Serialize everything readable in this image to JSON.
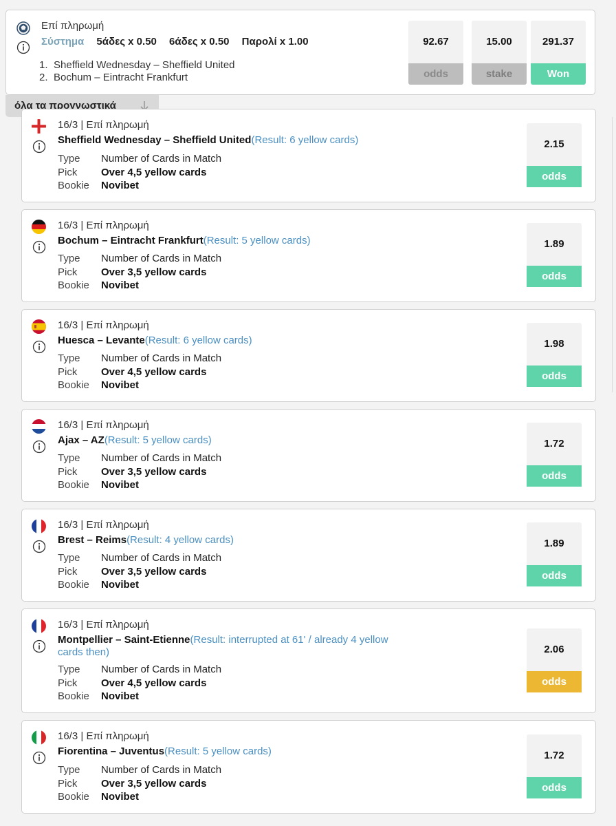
{
  "summary": {
    "payout_mode": "Επί πληρωμή",
    "system_label": "Σύστημα",
    "system_parts": [
      "5άδες x 0.50",
      "6άδες x 0.50",
      "Παρολί x 1.00"
    ],
    "matches": [
      {
        "num": "1.",
        "name": "Sheffield Wednesday – Sheffield United"
      },
      {
        "num": "2.",
        "name": "Bochum – Eintracht Frankfurt"
      }
    ],
    "boxes": [
      {
        "value": "92.67",
        "label": "odds"
      },
      {
        "value": "15.00",
        "label": "stake"
      },
      {
        "value": "291.37",
        "label": "Won"
      }
    ]
  },
  "all_predictions_tab": "όλα τα προγνωστικά",
  "row_labels": {
    "type": "Type",
    "pick": "Pick",
    "bookie": "Bookie"
  },
  "odds_label": "odds",
  "colors": {
    "won": "#5fd3a9",
    "void": "#ecb833",
    "result_text": "#4a8fc1"
  },
  "bets": [
    {
      "flag": "england-flag-icon",
      "date": "16/3",
      "payout": "Επί πληρωμή",
      "teams": "Sheffield Wednesday – Sheffield United",
      "result": "(Result: 6 yellow cards)",
      "type": "Number of Cards in Match",
      "pick": "Over 4,5 yellow cards",
      "bookie": "Novibet",
      "odds": "2.15",
      "status": "won"
    },
    {
      "flag": "germany-flag-icon",
      "date": "16/3",
      "payout": "Επί πληρωμή",
      "teams": "Bochum – Eintracht Frankfurt",
      "result": "(Result: 5 yellow cards)",
      "type": "Number of Cards in Match",
      "pick": "Over 3,5 yellow cards",
      "bookie": "Novibet",
      "odds": "1.89",
      "status": "won"
    },
    {
      "flag": "spain-flag-icon",
      "date": "16/3",
      "payout": "Επί πληρωμή",
      "teams": "Huesca – Levante",
      "result": "(Result: 6 yellow cards)",
      "type": "Number of Cards in Match",
      "pick": "Over 4,5 yellow cards",
      "bookie": "Novibet",
      "odds": "1.98",
      "status": "won"
    },
    {
      "flag": "netherlands-flag-icon",
      "date": "16/3",
      "payout": "Επί πληρωμή",
      "teams": "Ajax – AZ",
      "result": "(Result: 5 yellow cards)",
      "type": "Number of Cards in Match",
      "pick": "Over 3,5 yellow cards",
      "bookie": "Novibet",
      "odds": "1.72",
      "status": "won"
    },
    {
      "flag": "france-flag-icon",
      "date": "16/3",
      "payout": "Επί πληρωμή",
      "teams": "Brest – Reims",
      "result": "(Result: 4 yellow cards)",
      "type": "Number of Cards in Match",
      "pick": "Over 3,5 yellow cards",
      "bookie": "Novibet",
      "odds": "1.89",
      "status": "won"
    },
    {
      "flag": "france-flag-icon",
      "date": "16/3",
      "payout": "Επί πληρωμή",
      "teams": "Montpellier – Saint-Etienne",
      "result": "(Result: interrupted at 61' / already 4 yellow cards then)",
      "type": "Number of Cards in Match",
      "pick": "Over 4,5 yellow cards",
      "bookie": "Novibet",
      "odds": "2.06",
      "status": "void"
    },
    {
      "flag": "italy-flag-icon",
      "date": "16/3",
      "payout": "Επί πληρωμή",
      "teams": "Fiorentina – Juventus",
      "result": "(Result: 5 yellow cards)",
      "type": "Number of Cards in Match",
      "pick": "Over 3,5 yellow cards",
      "bookie": "Novibet",
      "odds": "1.72",
      "status": "won"
    }
  ]
}
